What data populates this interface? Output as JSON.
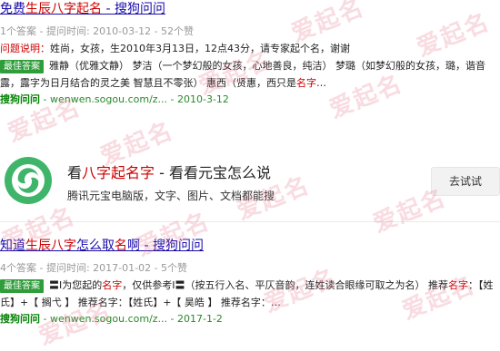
{
  "watermark": "爱起名",
  "results": [
    {
      "title_pre": "免费",
      "title_hl": "生辰八字起名",
      "title_post": " - 搜狗问问",
      "meta": "1个答案 - 提问时间: 2010-03-12 - 52个赞",
      "question_label": "问题说明：",
      "question_text": "姓尚，女孩，生2010年3月13日，12点43分，请专家起个名，谢谢",
      "badge": "最佳答案",
      "answer_text": "雅静（优雅文静） 梦洁（一个梦幻般的女孩，心地善良，纯洁） 梦璐（如梦幻般的女孩，璐，谐音露，露字为日月结合的灵之美 智慧且不零张） 惠西（贤惠，西只是",
      "answer_hl": "名字",
      "answer_tail": "…",
      "url_brand": "搜狗问问",
      "url_text": " - wenwen.sogou.com/z... - 2010-3-12"
    },
    {
      "title_pre": "知道",
      "title_hl": "生辰八字",
      "title_mid": "怎么取",
      "title_hl2": "名",
      "title_post": "啊 - 搜狗问问",
      "meta": "4个答案 - 提问时间: 2017-01-02 - 5个赞",
      "badge": "最佳答案",
      "answer_text": "〓I为您起的",
      "answer_hl": "名字",
      "answer_text2": "，仅供参考I〓（按五行入名、平仄音韵，连姓读合眼缘可取之为名） 推荐",
      "answer_hl2": "名字",
      "answer_text3": "：【姓氏】+【 搁弋 】 推荐名字：【姓氏】+【 昊皓 】 推荐名字：…",
      "url_brand": "搜狗问问",
      "url_text": " - wenwen.sogou.com/z... - 2017-1-2"
    }
  ],
  "yuanbao": {
    "title_pre": "看",
    "title_hl": "八字起名字",
    "title_post": " - 看看元宝怎么说",
    "desc": "腾讯元宝电脑版，文字、图片、文档都能搜",
    "button": "去试试"
  }
}
